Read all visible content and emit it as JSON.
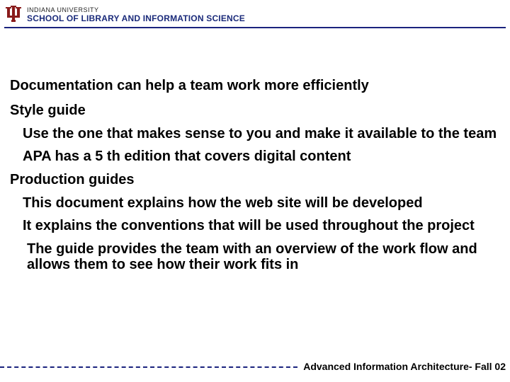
{
  "header": {
    "institution": "INDIANA UNIVERSITY",
    "school": "SCHOOL OF LIBRARY AND INFORMATION SCIENCE"
  },
  "content": {
    "line1": "Documentation can help a team work more efficiently",
    "line2": "Style guide",
    "line3": "Use the one that makes sense to you and make it available to the team",
    "line4": "APA has a 5 th edition that covers digital content",
    "line5": "Production guides",
    "line6": "This document explains how the web site will be developed",
    "line7": "It explains the conventions that will be used throughout the project",
    "line8": "The guide provides the team with an overview of the work flow and allows them to see how their work fits in"
  },
  "footer": {
    "text": "Advanced Information Architecture- Fall 02"
  }
}
